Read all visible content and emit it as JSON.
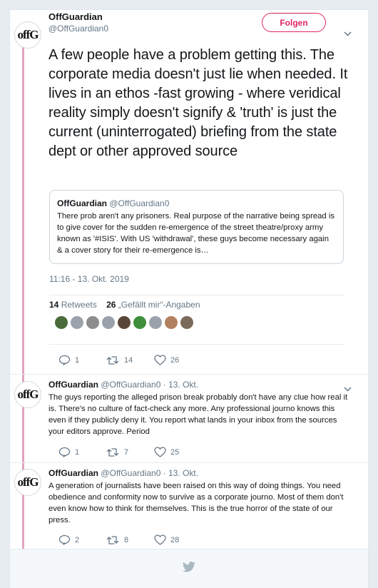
{
  "main_tweet": {
    "name": "OffGuardian",
    "handle": "@OffGuardian0",
    "follow_label": "Folgen",
    "text": "A few people have a problem getting this. The corporate media doesn't just lie when needed. It lives in an ethos -fast growing - where veridical reality simply doesn't signify & 'truth' is just the current (uninterrogated) briefing from the state dept or other approved source",
    "quote": {
      "name": "OffGuardian",
      "handle": "@OffGuardian0",
      "text": "There prob aren't any prisoners. Real purpose of the narrative being spread is to give cover for the sudden re-emergence of the street theatre/proxy army known as '#ISIS'. With US 'withdrawal', these guys become necessary again & a cover story for their re-emergence is…"
    },
    "timestamp": "11:16 - 13. Okt. 2019",
    "retweets_count": "14",
    "retweets_label": "Retweets",
    "likes_count": "26",
    "likes_label": "„Gefällt mir“-Angaben",
    "actions": {
      "replies": "1",
      "retweets": "14",
      "likes": "26"
    }
  },
  "likers": [
    {
      "color": "#4a6b3a"
    },
    {
      "color": "#9aa3ab"
    },
    {
      "color": "#8c8c8c"
    },
    {
      "color": "#9aa3ab"
    },
    {
      "color": "#5a4636"
    },
    {
      "color": "#3f8f3a"
    },
    {
      "color": "#9aa3ab"
    },
    {
      "color": "#b08060"
    },
    {
      "color": "#7a6a5a"
    }
  ],
  "replies": [
    {
      "name": "OffGuardian",
      "handle": "@OffGuardian0",
      "date": "· 13. Okt.",
      "text": "The guys reporting the alleged prison break probably don't have any clue how real it is. There's no culture of fact-check any more. Any professional journo knows this even if they publicly deny it. You report what lands in your inbox from the sources your editors approve. Period",
      "replies": "1",
      "retweets": "7",
      "likes": "25"
    },
    {
      "name": "OffGuardian",
      "handle": "@OffGuardian0",
      "date": "· 13. Okt.",
      "text": "A generation of journalists have been raised on this way of doing things. You need obedience and conformity now to survive as a corporate journo. Most of them don't even know how to think for themselves. This is the true horror of the state of our press.",
      "replies": "2",
      "retweets": "8",
      "likes": "28"
    }
  ],
  "colors": {
    "accent": "#e0245e",
    "thread_line": "#e2a3c0",
    "muted": "#657786",
    "twitter_blue": "#ccd6dd"
  },
  "avatar_logo_text": "offG",
  "footer_icon": "twitter-bird-icon"
}
